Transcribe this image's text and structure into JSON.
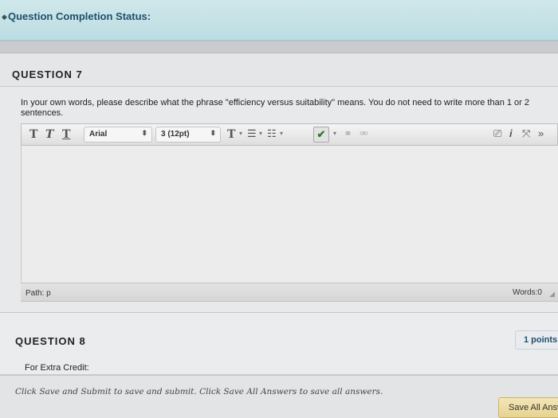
{
  "status_bar": {
    "title": "Question Completion Status:"
  },
  "question7": {
    "title": "QUESTION 7",
    "prompt": "In your own words, please describe what the phrase \"efficiency versus suitability\" means.  You do not need to write more than 1 or 2 sentences.",
    "toolbar": {
      "font_family": "Arial",
      "font_size": "3 (12pt)",
      "text_style_icons": [
        "T",
        "T",
        "T"
      ],
      "text_color_icon": "T"
    },
    "editor_value": "",
    "path_label": "Path: p",
    "word_count": "Words:0"
  },
  "question8": {
    "title": "QUESTION 8",
    "points": "1 points",
    "text": "For Extra Credit:"
  },
  "footer": {
    "note": "Click Save and Submit to save and submit. Click Save All Answers to save all answers.",
    "save_all_label": "Save All Answers"
  }
}
